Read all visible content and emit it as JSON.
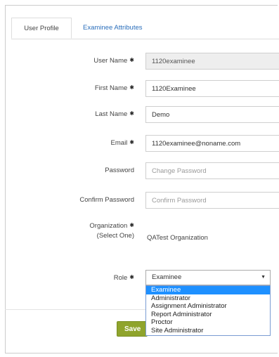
{
  "tabs": [
    {
      "label": "User Profile",
      "active": true
    },
    {
      "label": "Examinee Attributes",
      "active": false
    }
  ],
  "form": {
    "username": {
      "label": "User Name",
      "value": "1120examinee",
      "required": true
    },
    "first_name": {
      "label": "First Name",
      "value": "1120Examinee",
      "required": true
    },
    "last_name": {
      "label": "Last Name",
      "value": "Demo",
      "required": true
    },
    "email": {
      "label": "Email",
      "value": "1120examinee@noname.com",
      "required": true
    },
    "password": {
      "label": "Password",
      "placeholder": "Change Password"
    },
    "confirm_password": {
      "label": "Confirm Password",
      "placeholder": "Confirm Password"
    },
    "organization": {
      "label": "Organization",
      "sublabel": "(Select One)",
      "value": "QATest Organization"
    },
    "role": {
      "label": "Role",
      "selected": "Examinee",
      "options": [
        "Examinee",
        "Administrator",
        "Assignment Administrator",
        "Report Administrator",
        "Proctor",
        "Site Administrator"
      ]
    }
  },
  "required_marker": "✱",
  "actions": {
    "save_label": "Save"
  },
  "colors": {
    "link": "#2a6ebb",
    "save": "#8fa42c",
    "selected_option": "#1e90ff"
  }
}
